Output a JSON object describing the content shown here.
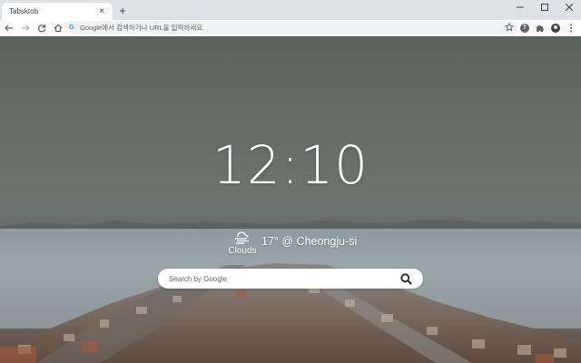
{
  "browser": {
    "tab": {
      "title": "Tabsktob",
      "close": "×"
    },
    "new_tab": "+",
    "window": {
      "minimize": "—",
      "maximize": "☐",
      "close": "✕"
    },
    "omnibox": {
      "engine_letter": "G",
      "placeholder": "Google에서 검색하거나 URL을 입력하세요."
    },
    "extension_letter": "T"
  },
  "clock": {
    "time": "12:10"
  },
  "weather": {
    "condition": "Clouds",
    "summary": "17° @ Cheongju-si",
    "icon": "cloud-wind-icon"
  },
  "search": {
    "placeholder": "Search by Google"
  },
  "colors": {
    "omnibox_bg": "#f1f3f4",
    "tabstrip_bg": "#dee1e6",
    "google_blue": "#4285f4"
  }
}
